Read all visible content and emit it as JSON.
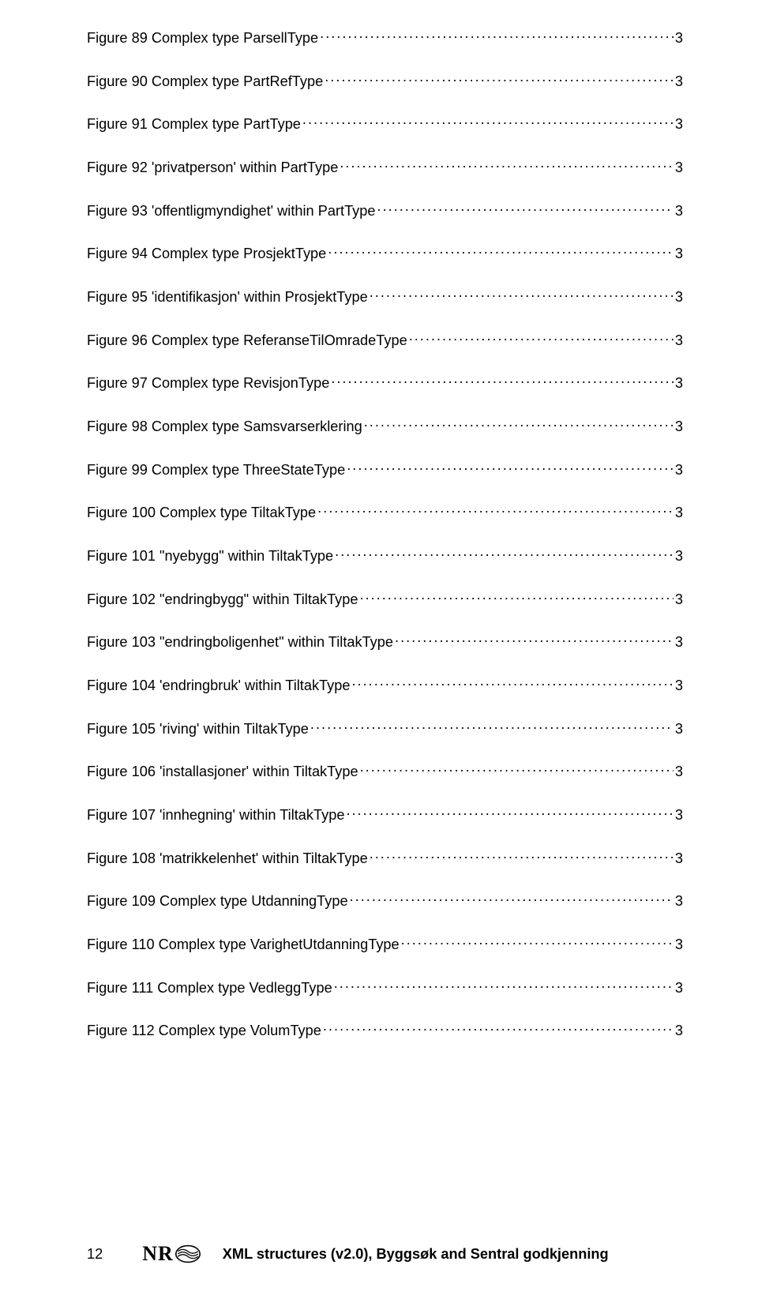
{
  "toc": [
    {
      "label": "Figure 89 Complex type ParsellType",
      "page": "3"
    },
    {
      "label": "Figure 90 Complex type PartRefType",
      "page": "3"
    },
    {
      "label": "Figure 91 Complex type PartType",
      "page": "3"
    },
    {
      "label": "Figure 92 'privatperson' within PartType",
      "page": "3"
    },
    {
      "label": "Figure 93 'offentligmyndighet' within PartType",
      "page": "3"
    },
    {
      "label": "Figure 94 Complex type ProsjektType",
      "page": "3"
    },
    {
      "label": "Figure 95 'identifikasjon' within ProsjektType",
      "page": "3"
    },
    {
      "label": "Figure 96 Complex type ReferanseTilOmradeType",
      "page": "3"
    },
    {
      "label": "Figure 97 Complex type RevisjonType",
      "page": "3"
    },
    {
      "label": "Figure 98 Complex type Samsvarserklering",
      "page": "3"
    },
    {
      "label": "Figure 99 Complex type ThreeStateType",
      "page": "3"
    },
    {
      "label": "Figure 100 Complex type TiltakType",
      "page": "3"
    },
    {
      "label": "Figure 101 \"nyebygg\" within TiltakType",
      "page": "3"
    },
    {
      "label": "Figure 102 \"endringbygg\" within TiltakType",
      "page": "3"
    },
    {
      "label": "Figure 103 \"endringboligenhet\" within TiltakType",
      "page": "3"
    },
    {
      "label": "Figure 104 'endringbruk' within TiltakType",
      "page": "3"
    },
    {
      "label": "Figure 105 'riving' within TiltakType",
      "page": "3"
    },
    {
      "label": "Figure 106 'installasjoner' within TiltakType",
      "page": "3"
    },
    {
      "label": "Figure 107 'innhegning' within TiltakType",
      "page": "3"
    },
    {
      "label": "Figure 108 'matrikkelenhet' within TiltakType",
      "page": "3"
    },
    {
      "label": "Figure 109 Complex type UtdanningType",
      "page": "3"
    },
    {
      "label": "Figure 110 Complex type VarighetUtdanningType",
      "page": "3"
    },
    {
      "label": "Figure 111 Complex type VedleggType",
      "page": "3"
    },
    {
      "label": "Figure 112 Complex type VolumType",
      "page": "3"
    }
  ],
  "footer": {
    "pageNumber": "12",
    "logoText": "NR",
    "title": "XML structures (v2.0), Byggsøk and Sentral godkjenning"
  }
}
